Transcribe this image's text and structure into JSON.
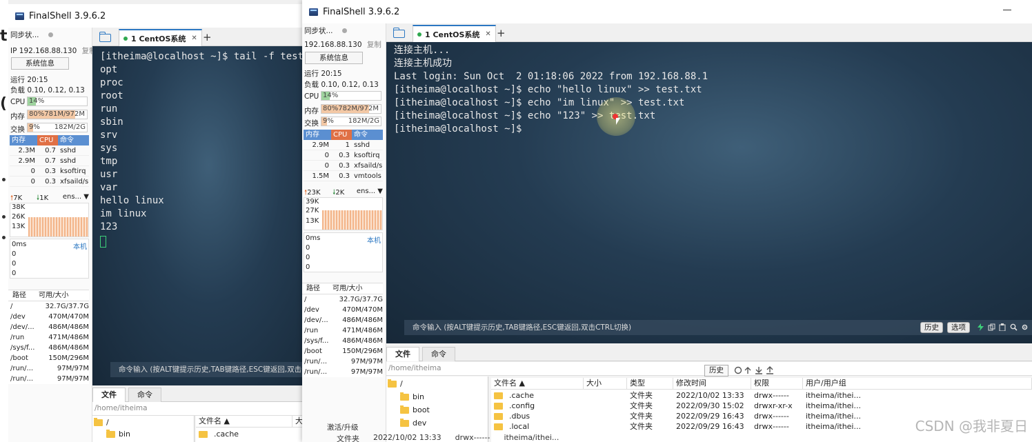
{
  "app_title": "FinalShell 3.9.6.2",
  "left_window": {
    "sidebar": {
      "sync_label": "同步状...",
      "ip_label": "IP 192.168.88.130",
      "copy_label": "复制",
      "sysinfo_button": "系统信息",
      "uptime": "运行 20:15",
      "load": "负载 0.10, 0.12, 0.13",
      "cpu_label": "CPU",
      "cpu_value": "14%",
      "cpu_fraction": 0.14,
      "mem_label": "内存",
      "mem_value": "80%781M/972M",
      "mem_fraction": 0.8,
      "swap_label": "交换",
      "swap_value": "9%",
      "swap_size": "182M/2G",
      "swap_fraction": 0.09,
      "proc_headers": [
        "内存",
        "CPU",
        "命令"
      ],
      "processes": [
        {
          "mem": "2.3M",
          "cpu": "0.7",
          "cmd": "sshd"
        },
        {
          "mem": "2.9M",
          "cpu": "0.7",
          "cmd": "sshd"
        },
        {
          "mem": "0",
          "cpu": "0.3",
          "cmd": "ksoftirq"
        },
        {
          "mem": "0",
          "cpu": "0.3",
          "cmd": "xfsaild/s"
        }
      ],
      "net_up": "7K",
      "net_down": "1K",
      "net_iface": "ens...",
      "net_ticks": [
        "38K",
        "26K",
        "13K"
      ],
      "latency_label": "0ms",
      "latency_host": "本机",
      "latency_ticks": [
        "0",
        "0",
        "0"
      ],
      "disk_headers": [
        "路径",
        "可用/大小"
      ],
      "disks": [
        {
          "path": "/",
          "size": "32.7G/37.7G"
        },
        {
          "path": "/dev",
          "size": "470M/470M"
        },
        {
          "path": "/dev/...",
          "size": "486M/486M"
        },
        {
          "path": "/run",
          "size": "471M/486M"
        },
        {
          "path": "/sys/f...",
          "size": "486M/486M"
        },
        {
          "path": "/boot",
          "size": "150M/296M"
        },
        {
          "path": "/run/...",
          "size": "97M/97M"
        },
        {
          "path": "/run/...",
          "size": "97M/97M"
        }
      ]
    },
    "tab_label": "1 CentOS系统",
    "terminal_lines": [
      "[itheima@localhost ~]$ tail -f test",
      "opt",
      "proc",
      "root",
      "run",
      "sbin",
      "srv",
      "sys",
      "tmp",
      "usr",
      "var",
      "hello linux",
      "im linux",
      "123"
    ],
    "cmd_hint": "命令输入 (按ALT键提示历史,TAB键路径,ESC键返回,双击",
    "bottom_tabs": [
      "文件",
      "命令"
    ],
    "path": "/home/itheima",
    "tree": [
      {
        "name": "/"
      },
      {
        "name": "bin"
      }
    ],
    "file_header_name": "文件名 ▲",
    "file_header_size": "大",
    "file_partial": ".cache"
  },
  "right_window": {
    "sidebar": {
      "sync_label": "同步状...",
      "ip_label": "192.168.88.130",
      "copy_label": "复制",
      "sysinfo_button": "系统信息",
      "uptime": "运行 20:15",
      "load": "负载 0.10, 0.12, 0.13",
      "cpu_label": "CPU",
      "cpu_value": "14%",
      "cpu_fraction": 0.14,
      "mem_label": "内存",
      "mem_value": "80%782M/972M",
      "mem_fraction": 0.8,
      "swap_label": "交换",
      "swap_value": "9%",
      "swap_size": "182M/2G",
      "swap_fraction": 0.09,
      "proc_headers": [
        "内存",
        "CPU",
        "命令"
      ],
      "processes": [
        {
          "mem": "2.9M",
          "cpu": "1",
          "cmd": "sshd"
        },
        {
          "mem": "0",
          "cpu": "0.3",
          "cmd": "ksoftirq"
        },
        {
          "mem": "0",
          "cpu": "0.3",
          "cmd": "xfsaild/s"
        },
        {
          "mem": "1.5M",
          "cpu": "0.3",
          "cmd": "vmtools"
        }
      ],
      "net_up": "23K",
      "net_down": "2K",
      "net_iface": "ens...",
      "net_ticks": [
        "39K",
        "27K",
        "13K"
      ],
      "latency_label": "0ms",
      "latency_host": "本机",
      "latency_ticks": [
        "0",
        "0",
        "0"
      ],
      "disk_headers": [
        "路径",
        "可用/大小"
      ],
      "disks": [
        {
          "path": "/",
          "size": "32.7G/37.7G"
        },
        {
          "path": "/dev",
          "size": "470M/470M"
        },
        {
          "path": "/dev/...",
          "size": "486M/486M"
        },
        {
          "path": "/run",
          "size": "471M/486M"
        },
        {
          "path": "/sys/f...",
          "size": "486M/486M"
        },
        {
          "path": "/boot",
          "size": "150M/296M"
        },
        {
          "path": "/run/...",
          "size": "97M/97M"
        },
        {
          "path": "/run/...",
          "size": "97M/97M"
        }
      ],
      "upgrade": "激活/升级"
    },
    "tab_label": "1 CentOS系统",
    "terminal_lines": [
      "连接主机...",
      "连接主机成功",
      "Last login: Sun Oct  2 01:18:06 2022 from 192.168.88.1",
      "[itheima@localhost ~]$ echo \"hello linux\" >> test.txt",
      "[itheima@localhost ~]$ echo \"im linux\" >> test.txt",
      "[itheima@localhost ~]$ echo \"123\" >> test.txt",
      "[itheima@localhost ~]$ "
    ],
    "cmd_hint": "命令输入 (按ALT键提示历史,TAB键路径,ESC键返回,双击CTRL切换)",
    "history_btn": "历史",
    "select_btn": "选项",
    "bottom_tabs": [
      "文件",
      "命令"
    ],
    "path": "/home/itheima",
    "path_history_btn": "历史",
    "tree": [
      {
        "name": "/"
      },
      {
        "name": "bin"
      },
      {
        "name": "boot"
      },
      {
        "name": "dev"
      }
    ],
    "file_headers": [
      "文件名 ▲",
      "大小",
      "类型",
      "修改时间",
      "权限",
      "用户/用户组"
    ],
    "files": [
      {
        "name": ".cache",
        "size": "",
        "type": "文件夹",
        "mtime": "2022/10/02 13:33",
        "perm": "drwx------",
        "owner": "itheima/ithei..."
      },
      {
        "name": ".config",
        "size": "",
        "type": "文件夹",
        "mtime": "2022/09/30 15:02",
        "perm": "drwxr-xr-x",
        "owner": "itheima/ithei..."
      },
      {
        "name": ".dbus",
        "size": "",
        "type": "文件夹",
        "mtime": "2022/09/29 16:43",
        "perm": "drwx------",
        "owner": "itheima/ithei..."
      },
      {
        "name": ".local",
        "size": "",
        "type": "文件夹",
        "mtime": "2022/09/29 16:43",
        "perm": "drwx------",
        "owner": "itheima/ithei..."
      }
    ],
    "bottom_peek": {
      "type": "文件夹",
      "mtime": "2022/10/02 13:33",
      "perm": "drwx------",
      "owner": "itheima/ithei..."
    }
  },
  "watermark": "CSDN @我非夏日",
  "left_strip_chars": [
    "t",
    "(",
    "!"
  ]
}
